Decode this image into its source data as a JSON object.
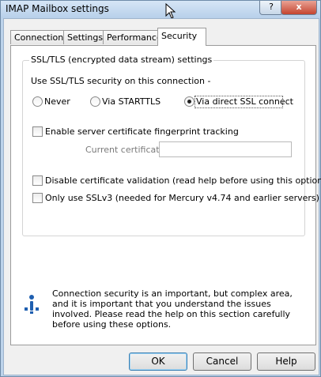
{
  "window": {
    "title": "IMAP Mailbox settings",
    "help_glyph": "?",
    "close_glyph": "x"
  },
  "tabs": [
    "Connection",
    "Settings",
    "Performance",
    "Security"
  ],
  "active_tab": "Security",
  "security": {
    "group_title": "SSL/TLS (encrypted data stream) settings",
    "use_label": "Use SSL/TLS security on this connection -",
    "radios": [
      {
        "label": "Never",
        "checked": false
      },
      {
        "label": "Via STARTTLS",
        "checked": false
      },
      {
        "label": "Via direct SSL connect",
        "checked": true
      }
    ],
    "fingerprint_label": "Enable server certificate fingerprint tracking",
    "fingerprint_checked": false,
    "current_cert_label": "Current certificate",
    "current_cert_value": "",
    "disable_validation_label": "Disable certificate validation (read help before using this option)",
    "disable_validation_checked": false,
    "sslv3_label": "Only use SSLv3 (needed for Mercury v4.74 and earlier servers)",
    "sslv3_checked": false
  },
  "info": {
    "icon": "info-icon",
    "text": "Connection security is an important, but complex area, and it is important that you understand the issues involved. Please read the help on this section carefully before using these options."
  },
  "buttons": {
    "ok": "OK",
    "cancel": "Cancel",
    "help": "Help"
  }
}
